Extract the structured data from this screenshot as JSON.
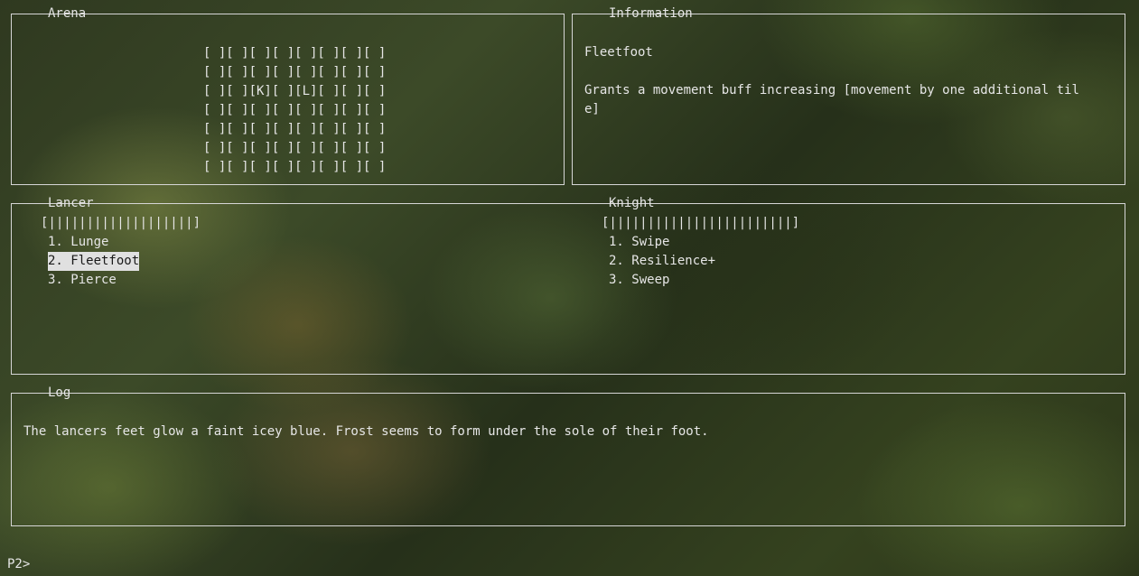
{
  "arena": {
    "title": "Arena",
    "rows": [
      "[ ][ ][ ][ ][ ][ ][ ][ ]",
      "[ ][ ][ ][ ][ ][ ][ ][ ]",
      "[ ][ ][K][ ][L][ ][ ][ ]",
      "[ ][ ][ ][ ][ ][ ][ ][ ]",
      "[ ][ ][ ][ ][ ][ ][ ][ ]",
      "[ ][ ][ ][ ][ ][ ][ ][ ]",
      "[ ][ ][ ][ ][ ][ ][ ][ ]"
    ]
  },
  "information": {
    "title": "Information",
    "heading": "Fleetfoot",
    "line1": "Grants a movement buff increasing [movement by one additional til",
    "line2": "e]"
  },
  "lancer": {
    "title": "Lancer",
    "health_bar": "[|||||||||||||||||||]",
    "moves": [
      "1. Lunge",
      "2. Fleetfoot",
      "3. Pierce"
    ]
  },
  "knight": {
    "title": "Knight",
    "health_bar": "[||||||||||||||||||||||||]",
    "moves": [
      "1. Swipe",
      "2. Resilience+",
      "3. Sweep"
    ]
  },
  "log": {
    "title": "Log",
    "text": "The lancers feet glow a faint icey blue. Frost seems to form under the sole of their foot."
  },
  "prompt": {
    "text": "P2>"
  }
}
